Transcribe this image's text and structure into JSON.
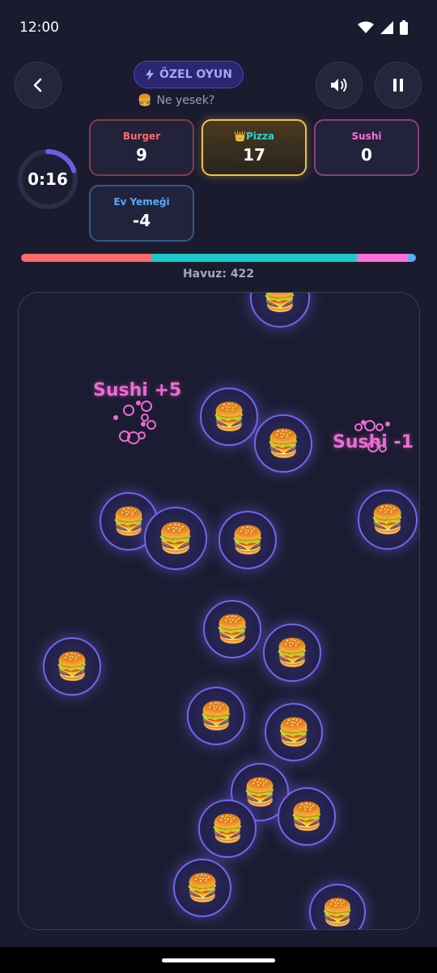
{
  "status": {
    "time": "12:00"
  },
  "header": {
    "mode_label": "ÖZEL OYUN",
    "subtitle": "Ne yesek?",
    "back_icon": "chevron-left-icon",
    "sound_icon": "volume-icon",
    "pause_icon": "pause-icon"
  },
  "timer": {
    "text": "0:16",
    "remaining_fraction": 0.2,
    "color": "#6c5ce7"
  },
  "scores": [
    {
      "label": "Burger",
      "value": "9",
      "color": "#ff6b6b",
      "border": "#8a3a4a",
      "leader": false
    },
    {
      "label": "Pizza",
      "value": "17",
      "color": "#2bd4d4",
      "border": "#f0c14b",
      "leader": true,
      "crown": "👑"
    },
    {
      "label": "Sushi",
      "value": "0",
      "color": "#ff6fd8",
      "border": "#8a3f86",
      "leader": false
    },
    {
      "label": "Ev Yemeği",
      "value": "-4",
      "color": "#5aa9ff",
      "border": "#2f5a8a",
      "leader": false
    }
  ],
  "progress": {
    "segments": [
      {
        "name": "Burger",
        "fraction": 0.33,
        "color": "#ff6b6b"
      },
      {
        "name": "Pizza",
        "fraction": 0.52,
        "color": "#1ec8c8"
      },
      {
        "name": "Sushi",
        "fraction": 0.13,
        "color": "#ff6fd8"
      },
      {
        "name": "Ev Yemeği",
        "fraction": 0.02,
        "color": "#5aa9ff"
      }
    ]
  },
  "pool": {
    "text": "Havuz: 422"
  },
  "arena": {
    "item_emoji": "🍔",
    "floating_texts": [
      "Sushi +5",
      "Sushi -1"
    ]
  }
}
